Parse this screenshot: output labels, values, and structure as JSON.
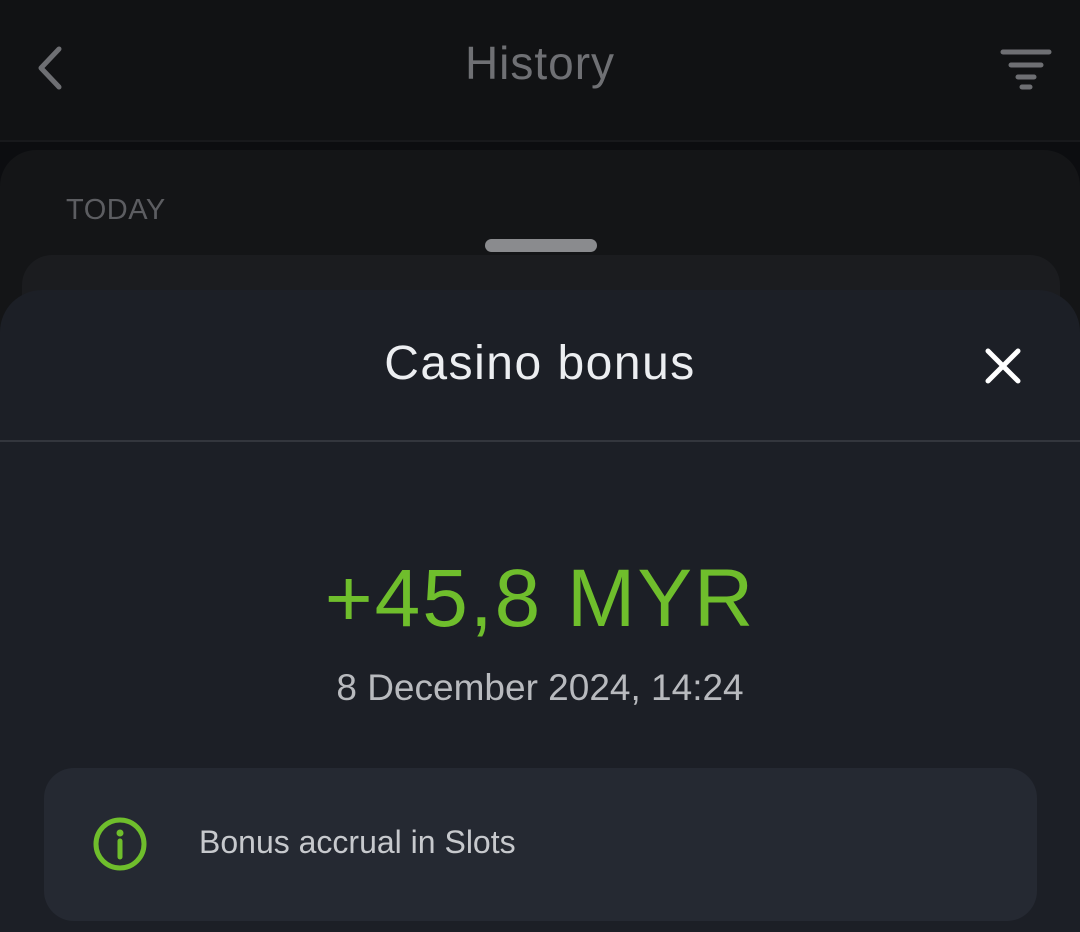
{
  "header": {
    "title": "History",
    "back_icon": "chevron-left-icon",
    "filter_icon": "filter-icon"
  },
  "list": {
    "section_label": "TODAY"
  },
  "sheet": {
    "title": "Casino bonus",
    "close_icon": "close-icon",
    "amount": "+45,8 MYR",
    "datetime": "8 December 2024, 14:24",
    "info": {
      "icon": "info-icon",
      "text": "Bonus accrual in Slots"
    }
  },
  "colors": {
    "accent_green": "#6fbe2c",
    "sheet_bg": "#1c1f26",
    "info_bg": "#252932",
    "page_bg": "#0c0d10"
  }
}
